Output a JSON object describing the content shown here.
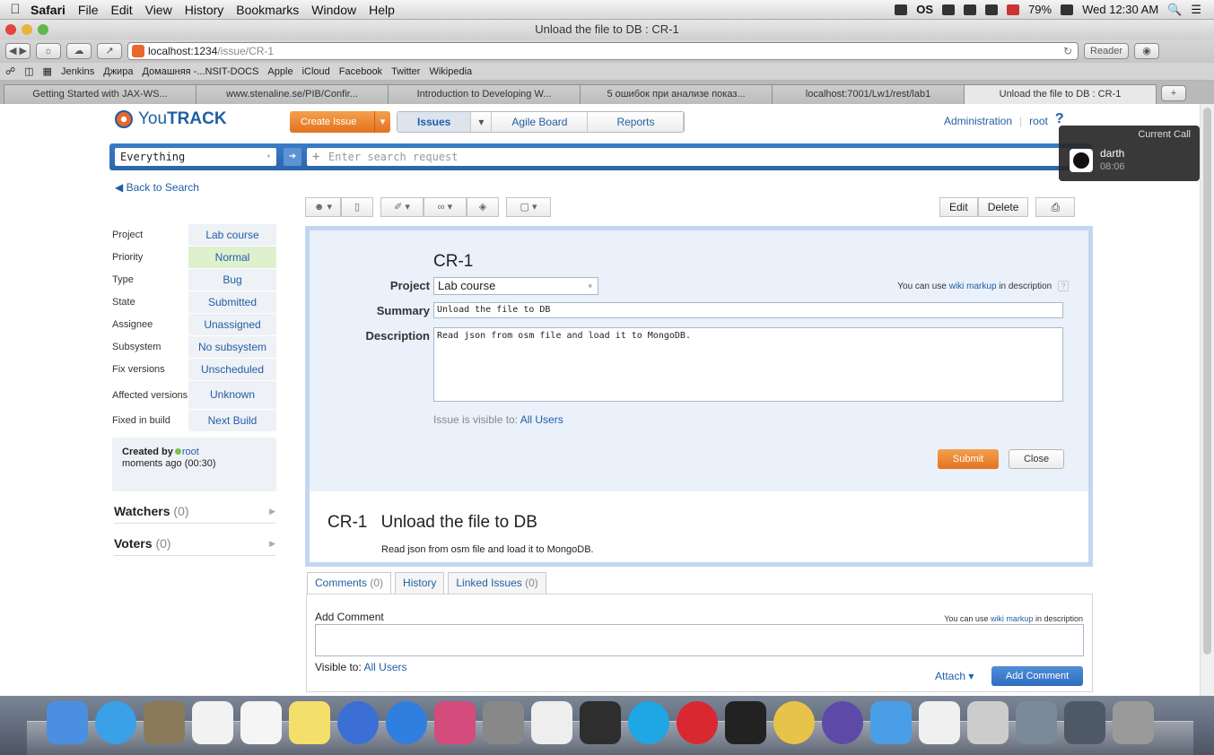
{
  "menubar": {
    "app": "Safari",
    "items": [
      "File",
      "Edit",
      "View",
      "History",
      "Bookmarks",
      "Window",
      "Help"
    ],
    "battery": "79%",
    "clock": "Wed 12:30 AM",
    "status_os": "OS"
  },
  "window": {
    "title": "Unload the file to DB : CR-1"
  },
  "url": {
    "host": "localhost:1234",
    "path": "/issue/CR-1",
    "reader": "Reader"
  },
  "bookmarks": [
    "Jenkins",
    "Джира",
    "Домашняя -...NSIT-DOCS",
    "Apple",
    "iCloud",
    "Facebook",
    "Twitter",
    "Wikipedia"
  ],
  "tabs": [
    "Getting Started with JAX-WS...",
    "www.stenaline.se/PIB/Confir...",
    "Introduction to Developing W...",
    "5 ошибок при анализе показ...",
    "localhost:7001/Lw1/rest/lab1",
    "Unload the file to DB : CR-1"
  ],
  "header": {
    "logo_prefix": "You",
    "logo_bold": "TRACK",
    "create": "Create Issue",
    "nav": [
      "Issues",
      "Agile Board",
      "Reports"
    ],
    "admin": "Administration",
    "user": "root",
    "help": "?"
  },
  "search": {
    "scope": "Everything",
    "placeholder": "Enter search request"
  },
  "call": {
    "title": "Current Call",
    "name": "darth",
    "time": "08:06"
  },
  "back": "Back to Search",
  "fields": [
    {
      "label": "Project",
      "value": "Lab course"
    },
    {
      "label": "Priority",
      "value": "Normal"
    },
    {
      "label": "Type",
      "value": "Bug"
    },
    {
      "label": "State",
      "value": "Submitted"
    },
    {
      "label": "Assignee",
      "value": "Unassigned"
    },
    {
      "label": "Subsystem",
      "value": "No subsystem"
    },
    {
      "label": "Fix versions",
      "value": "Unscheduled"
    },
    {
      "label": "Affected versions",
      "value": "Unknown"
    },
    {
      "label": "Fixed in build",
      "value": "Next Build"
    }
  ],
  "created": {
    "label": "Created by",
    "user": "root",
    "when": "moments ago (00:30)"
  },
  "watchers": {
    "label": "Watchers",
    "count": "(0)"
  },
  "voters": {
    "label": "Voters",
    "count": "(0)"
  },
  "actions": {
    "edit": "Edit",
    "delete": "Delete"
  },
  "form": {
    "id": "CR-1",
    "project_label": "Project",
    "project": "Lab course",
    "summary_label": "Summary",
    "summary": "Unload the file to DB",
    "description_label": "Description",
    "description": "Read json from osm file and load it to MongoDB.",
    "wiki_pre": "You can use",
    "wiki_link": "wiki markup",
    "wiki_post": "in description",
    "visible_pre": "Issue is visible to:",
    "visible_link": "All Users",
    "submit": "Submit",
    "close": "Close"
  },
  "view": {
    "id": "CR-1",
    "summary": "Unload the file to DB",
    "description": "Read json from osm file and load it to MongoDB."
  },
  "comment_tabs": [
    {
      "label": "Comments",
      "count": "(0)"
    },
    {
      "label": "History",
      "count": ""
    },
    {
      "label": "Linked Issues",
      "count": "(0)"
    }
  ],
  "comment": {
    "label": "Add Comment",
    "wiki_pre": "You can use",
    "wiki_link": "wiki markup",
    "wiki_post": "in description",
    "visible_pre": "Visible to:",
    "visible_link": "All Users",
    "attach": "Attach",
    "button": "Add Comment"
  },
  "dock_apps": [
    "finder-icon",
    "safari-icon",
    "preview-icon",
    "calendar-icon",
    "reminders-icon",
    "stickies-icon",
    "itunes-icon",
    "app-store-icon",
    "intellij-icon",
    "system-preferences-icon",
    "textedit-icon",
    "activity-monitor-icon",
    "skype-icon",
    "lastfm-icon",
    "terminal-icon",
    "chrome-icon",
    "eclipse-icon",
    "mail-icon",
    "document-icon",
    "window-icon",
    "window2-icon",
    "window3-icon",
    "trash-icon"
  ],
  "colors": {
    "accent_blue": "#2a66ad",
    "orange": "#e4721e",
    "link": "#1f5fa6",
    "panel": "#eaf1fb"
  }
}
